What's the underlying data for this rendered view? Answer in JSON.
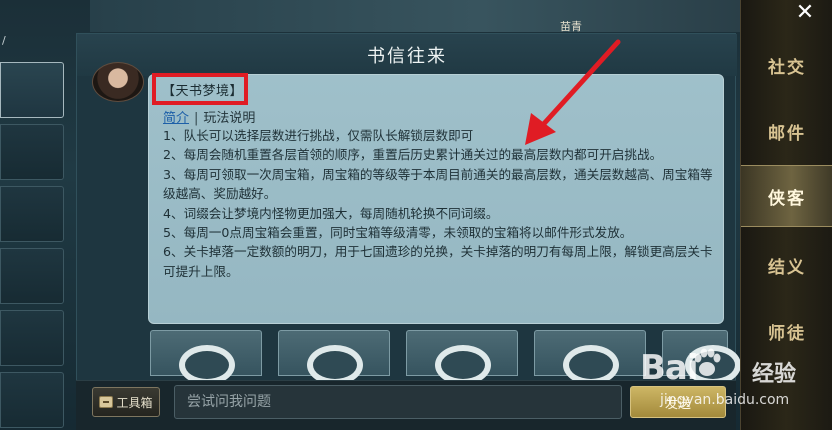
{
  "window": {
    "title": "书信往来"
  },
  "right_nav": {
    "close_symbol": "✕",
    "items": [
      {
        "label": "社交",
        "active": false
      },
      {
        "label": "邮件",
        "active": false
      },
      {
        "label": "侠客",
        "active": true
      },
      {
        "label": "结义",
        "active": false
      },
      {
        "label": "师徒",
        "active": false
      }
    ]
  },
  "top_strip": {
    "partial_text": "苗青"
  },
  "left_col": {
    "slash": "/"
  },
  "message": {
    "tag": "【天书梦境】",
    "tabs": {
      "intro_link": "简介",
      "separator": "|",
      "rules": "玩法说明"
    },
    "lines": [
      "1、队长可以选择层数进行挑战，仅需队长解锁层数即可",
      "2、每周会随机重置各层首领的顺序，重置后历史累计通关过的最高层数内都可开启挑战。",
      "3、每周可领取一次周宝箱，周宝箱的等级等于本周目前通关的最高层数，通关层数越高、周宝箱等级越高、奖励越好。",
      "4、词缀会让梦境内怪物更加强大，每周随机轮换不同词缀。",
      "5、每周一0点周宝箱会重置，同时宝箱等级清零，未领取的宝箱将以邮件形式发放。",
      "6、关卡掉落一定数额的明刀，用于七国遗珍的兑换，关卡掉落的明刀有每周上限，解锁更高层关卡可提升上限。"
    ]
  },
  "bottom": {
    "toolbox_label": "工具箱",
    "input_placeholder": "尝试问我问题",
    "send_label": "发送"
  },
  "watermark": {
    "main": "Bai",
    "suffix": "经验",
    "url": "jingyan.baidu.com"
  },
  "colors": {
    "highlight_box": "#e01c24",
    "arrow": "#e01c24",
    "accent_gold": "#d8c392"
  },
  "icons": [
    "close-icon",
    "toolbox-icon",
    "avatar-portrait",
    "baidu-paw-icon"
  ]
}
